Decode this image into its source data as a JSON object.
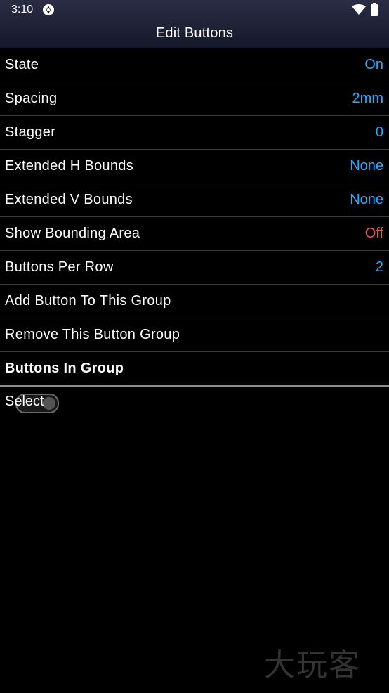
{
  "status_bar": {
    "time": "3:10",
    "app_icon": "app-logo-icon",
    "wifi_icon": "wifi-icon",
    "battery_icon": "battery-icon"
  },
  "header": {
    "title": "Edit Buttons"
  },
  "settings": [
    {
      "label": "State",
      "value": "On",
      "value_color": "#2ea8ff"
    },
    {
      "label": "Spacing",
      "value": "2mm",
      "value_color": "#2ea8ff"
    },
    {
      "label": "Stagger",
      "value": "0",
      "value_color": "#2ea8ff"
    },
    {
      "label": "Extended H Bounds",
      "value": "None",
      "value_color": "#2ea8ff"
    },
    {
      "label": "Extended V Bounds",
      "value": "None",
      "value_color": "#2ea8ff"
    },
    {
      "label": "Show Bounding Area",
      "value": "Off",
      "value_color": "#ff4c4c"
    },
    {
      "label": "Buttons Per Row",
      "value": "2",
      "value_color": "#2ea8ff"
    }
  ],
  "actions": [
    {
      "label": "Add Button To This Group"
    },
    {
      "label": "Remove This Button Group"
    }
  ],
  "section": {
    "label": "Buttons In Group"
  },
  "select": {
    "label": "Select"
  },
  "watermark": {
    "text": "大玩客"
  },
  "colors": {
    "accent_blue": "#2ea8ff",
    "off_red": "#ff4c4c",
    "divider": "#3a3a3a"
  }
}
